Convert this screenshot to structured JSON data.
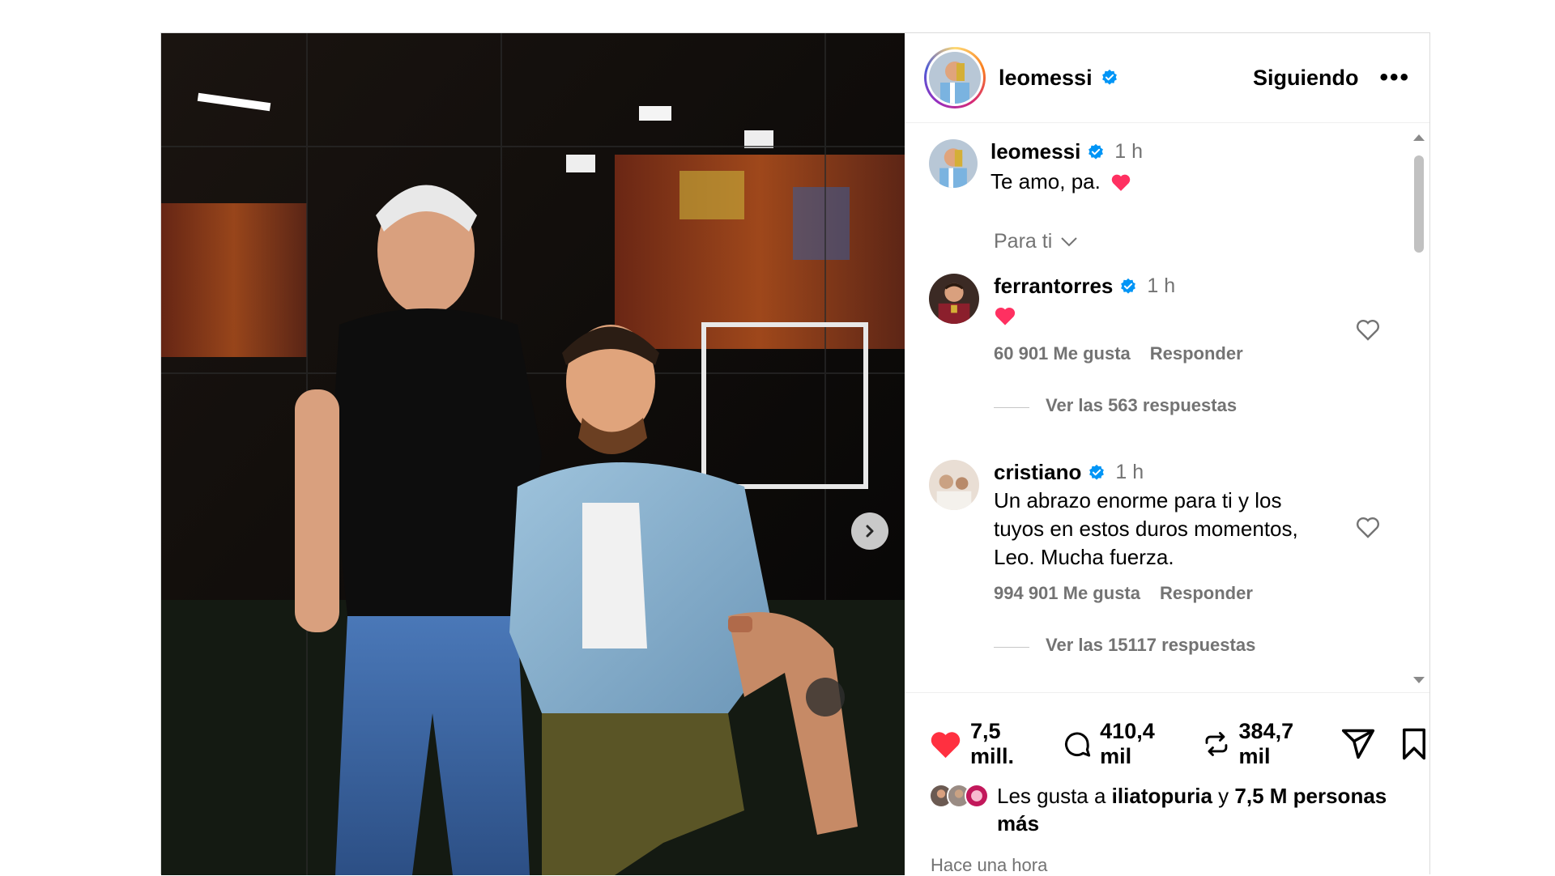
{
  "header": {
    "username": "leomessi",
    "following_label": "Siguiendo",
    "more_label": "•••"
  },
  "caption": {
    "username": "leomessi",
    "time": "1 h",
    "text": "Te amo, pa."
  },
  "filter": {
    "label": "Para ti"
  },
  "comments": [
    {
      "username": "ferrantorres",
      "time": "1 h",
      "likes": "60 901 Me gusta",
      "reply_label": "Responder",
      "replies_label": "Ver las 563 respuestas"
    },
    {
      "username": "cristiano",
      "time": "1 h",
      "text": "Un abrazo enorme para ti y los tuyos en estos duros momentos, Leo. Mucha fuerza.",
      "likes": "994 901 Me gusta",
      "reply_label": "Responder",
      "replies_label": "Ver las 15117 respuestas"
    }
  ],
  "actions": {
    "likes": "7,5 mill.",
    "comments": "410,4 mil",
    "reposts": "384,7 mil"
  },
  "liked_by": {
    "prefix": "Les gusta a",
    "user": "iliatopuria",
    "middle": "y",
    "count": "7,5 M personas más"
  },
  "timestamp": "Hace una hora",
  "colors": {
    "like_red": "#ff3040",
    "verified_blue": "#0095f6",
    "muted": "#737373"
  },
  "icons": [
    "chevron-right-icon",
    "verified-icon",
    "heart-icon",
    "comment-icon",
    "repost-icon",
    "share-icon",
    "bookmark-icon",
    "chevron-down-icon"
  ]
}
